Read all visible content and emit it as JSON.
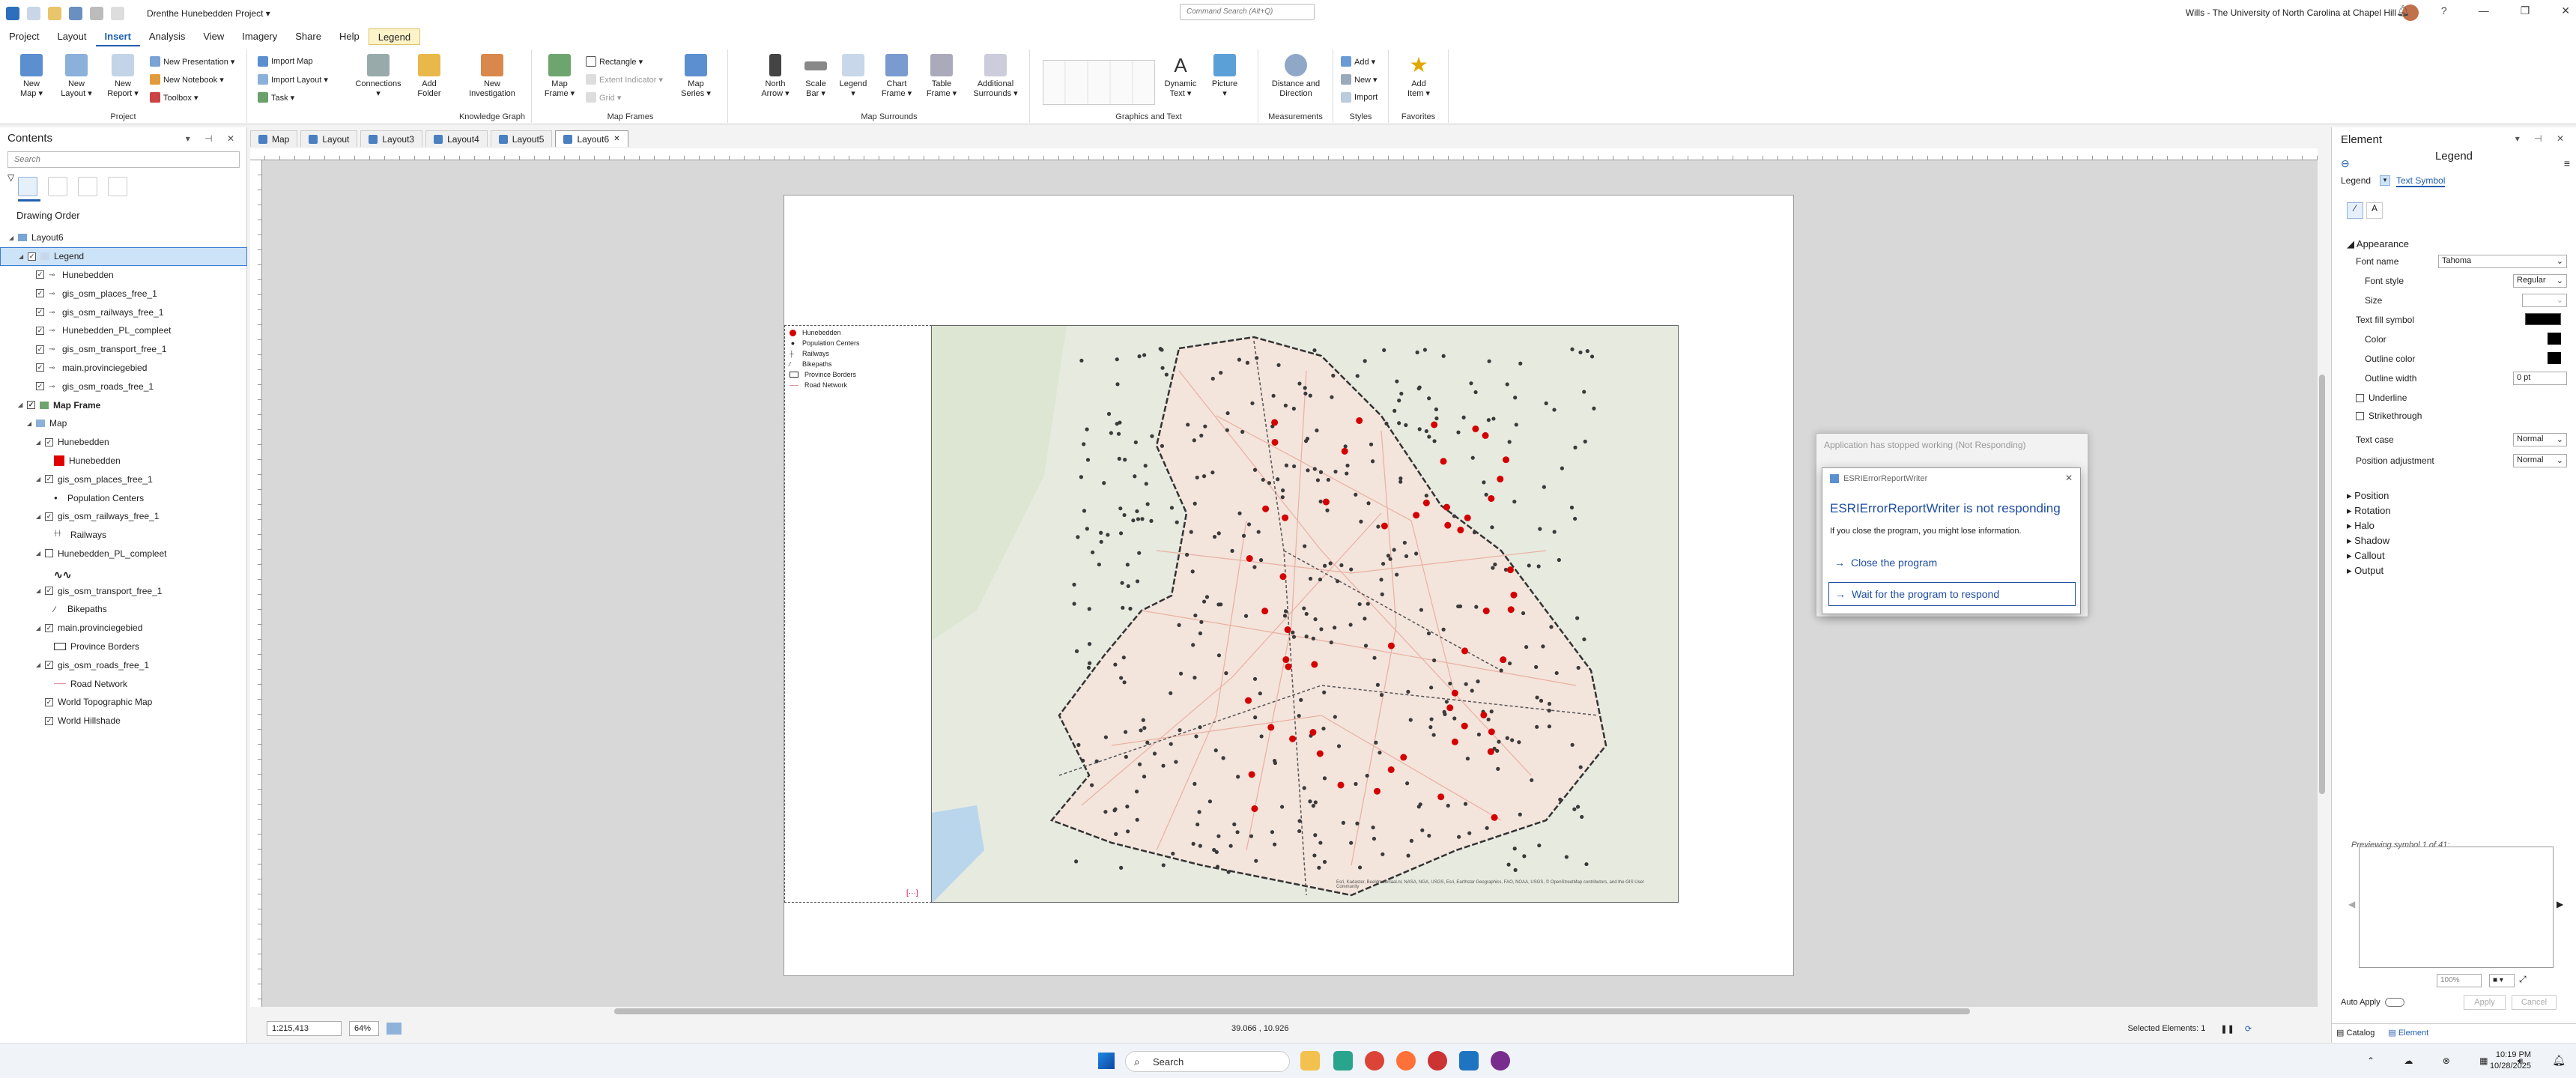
{
  "titlebar": {
    "project_title": "Drenthe Hunebedden Project ▾",
    "command_search": "Command Search (Alt+Q)",
    "user": "Wills - The University of North Carolina at Chapel Hill"
  },
  "tabs": [
    "Project",
    "Layout",
    "Insert",
    "Analysis",
    "View",
    "Imagery",
    "Share",
    "Help"
  ],
  "context_tab": "Legend",
  "ribbon": {
    "project_group": "Project",
    "new_map": "New\nMap ▾",
    "new_layout": "New\nLayout ▾",
    "new_report": "New\nReport ▾",
    "new_presentation": "New Presentation ▾",
    "new_notebook": "New Notebook ▾",
    "toolbox": "Toolbox ▾",
    "import_map": "Import Map",
    "import_layout": "Import Layout ▾",
    "task": "Task ▾",
    "connections": "Connections\n▾",
    "add_folder": "Add\nFolder",
    "kg_group": "Knowledge Graph",
    "new_investigation": "New\nInvestigation",
    "mf_group": "Map Frames",
    "map_frame": "Map\nFrame ▾",
    "rectangle": "Rectangle ▾",
    "extent_indicator": "Extent Indicator ▾",
    "grid": "Grid ▾",
    "map_series": "Map\nSeries ▾",
    "ms_group": "Map Surrounds",
    "north_arrow": "North\nArrow ▾",
    "scale_bar": "Scale\nBar ▾",
    "legend": "Legend\n▾",
    "chart_frame": "Chart\nFrame ▾",
    "table_frame": "Table\nFrame ▾",
    "additional_surrounds": "Additional\nSurrounds ▾",
    "gt_group": "Graphics and Text",
    "dynamic_text": "Dynamic\nText ▾",
    "picture": "Picture\n▾",
    "meas_group": "Measurements",
    "distance_direction": "Distance and\nDirection",
    "styles_group": "Styles",
    "add": "Add ▾",
    "new": "New ▾",
    "import": "Import",
    "fav_group": "Favorites",
    "add_item": "Add\nItem ▾"
  },
  "contents": {
    "title": "Contents",
    "search_placeholder": "Search",
    "drawing_order": "Drawing Order",
    "rows": [
      {
        "label": "Layout6",
        "indent": 0,
        "tri": "◢",
        "cb": false,
        "sym": "layout"
      },
      {
        "label": "Legend",
        "indent": 1,
        "tri": "◢",
        "cb": true,
        "sym": "legend",
        "selected": true
      },
      {
        "label": "Hunebedden",
        "indent": 2,
        "tri": "",
        "cb": true,
        "sym": "line"
      },
      {
        "label": "gis_osm_places_free_1",
        "indent": 2,
        "tri": "",
        "cb": true,
        "sym": "line"
      },
      {
        "label": "gis_osm_railways_free_1",
        "indent": 2,
        "tri": "",
        "cb": true,
        "sym": "line"
      },
      {
        "label": "Hunebedden_PL_compleet",
        "indent": 2,
        "tri": "",
        "cb": true,
        "sym": "line"
      },
      {
        "label": "gis_osm_transport_free_1",
        "indent": 2,
        "tri": "",
        "cb": true,
        "sym": "line"
      },
      {
        "label": "main.provinciegebied",
        "indent": 2,
        "tri": "",
        "cb": true,
        "sym": "line"
      },
      {
        "label": "gis_osm_roads_free_1",
        "indent": 2,
        "tri": "",
        "cb": true,
        "sym": "line"
      },
      {
        "label": "Map Frame",
        "indent": 1,
        "tri": "◢",
        "cb": true,
        "sym": "frame",
        "bold": true
      },
      {
        "label": "Map",
        "indent": 2,
        "tri": "◢",
        "cb": false,
        "sym": "map"
      },
      {
        "label": "Hunebedden",
        "indent": 3,
        "tri": "◢",
        "cb": true,
        "sym": ""
      },
      {
        "label": "Hunebedden",
        "indent": 4,
        "tri": "",
        "cb": false,
        "sym": "redsq"
      },
      {
        "label": "gis_osm_places_free_1",
        "indent": 3,
        "tri": "◢",
        "cb": true,
        "sym": ""
      },
      {
        "label": "Population Centers",
        "indent": 4,
        "tri": "",
        "cb": false,
        "sym": "dot"
      },
      {
        "label": "gis_osm_railways_free_1",
        "indent": 3,
        "tri": "◢",
        "cb": true,
        "sym": ""
      },
      {
        "label": "Railways",
        "indent": 4,
        "tri": "",
        "cb": false,
        "sym": "rail"
      },
      {
        "label": "Hunebedden_PL_compleet",
        "indent": 3,
        "tri": "◢",
        "cb": "empty",
        "sym": ""
      },
      {
        "label": "",
        "indent": 4,
        "tri": "",
        "cb": false,
        "sym": "squiggle"
      },
      {
        "label": "gis_osm_transport_free_1",
        "indent": 3,
        "tri": "◢",
        "cb": true,
        "sym": ""
      },
      {
        "label": "Bikepaths",
        "indent": 4,
        "tri": "",
        "cb": false,
        "sym": "bike"
      },
      {
        "label": "main.provinciegebied",
        "indent": 3,
        "tri": "◢",
        "cb": true,
        "sym": ""
      },
      {
        "label": "Province Borders",
        "indent": 4,
        "tri": "",
        "cb": false,
        "sym": "box"
      },
      {
        "label": "gis_osm_roads_free_1",
        "indent": 3,
        "tri": "◢",
        "cb": true,
        "sym": ""
      },
      {
        "label": "Road Network",
        "indent": 4,
        "tri": "",
        "cb": false,
        "sym": "road"
      },
      {
        "label": "World Topographic Map",
        "indent": 3,
        "tri": "",
        "cb": true,
        "sym": ""
      },
      {
        "label": "World Hillshade",
        "indent": 3,
        "tri": "",
        "cb": true,
        "sym": ""
      }
    ]
  },
  "view_tabs": [
    {
      "label": "Map",
      "active": false
    },
    {
      "label": "Layout",
      "active": false
    },
    {
      "label": "Layout3",
      "active": false
    },
    {
      "label": "Layout4",
      "active": false
    },
    {
      "label": "Layout5",
      "active": false
    },
    {
      "label": "Layout6",
      "active": true
    }
  ],
  "legend_items": [
    "Hunebedden",
    "Population Centers",
    "Railways",
    "Bikepaths",
    "Province Borders",
    "Road Network"
  ],
  "map_credits": "Esri, Kadaster, Beeldmateriaal.nl, NASA, NGA, USGS, Esri, Earthstar Geographics, FAO, NOAA, USGS, © OpenStreetMap contributors, and the GIS User Community",
  "statusbar": {
    "scale": "1:215,413",
    "zoom": "64%",
    "coords": "39.066 , 10.926",
    "selected": "Selected Elements: 1"
  },
  "element_pane": {
    "title": "Element",
    "subtitle": "Legend",
    "dropdown": "Legend",
    "tab": "Text Symbol",
    "appearance": "Appearance",
    "font_name_label": "Font name",
    "font_name": "Tahoma",
    "font_style_label": "Font style",
    "font_style": "Regular",
    "size_label": "Size",
    "text_fill_label": "Text fill symbol",
    "color_label": "Color",
    "outline_color_label": "Outline color",
    "outline_width_label": "Outline width",
    "outline_width": "0 pt",
    "underline": "Underline",
    "strikethrough": "Strikethrough",
    "text_case_label": "Text case",
    "text_case": "Normal",
    "position_adj_label": "Position adjustment",
    "position_adj": "Normal",
    "sections": [
      "Position",
      "Rotation",
      "Halo",
      "Shadow",
      "Callout",
      "Output"
    ],
    "preview_label": "Previewing symbol 1 of 41:",
    "preview_zoom": "100%",
    "auto_apply": "Auto Apply",
    "apply": "Apply",
    "cancel": "Cancel",
    "bottom_tabs": [
      "Catalog",
      "Element"
    ]
  },
  "not_responding": {
    "title": "Application has stopped working (Not Responding)"
  },
  "dialog": {
    "app": "ESRIErrorReportWriter",
    "heading": "ESRIErrorReportWriter is not responding",
    "info": "If you close the program, you might lose information.",
    "close": "Close the program",
    "wait": "Wait for the program to respond"
  },
  "taskbar": {
    "search": "Search",
    "time": "10:19 PM",
    "date": "10/28/2025"
  },
  "colors": {
    "accent": "#1f5fae",
    "hunebed_red": "#d40000",
    "selection": "#cde3f7"
  }
}
